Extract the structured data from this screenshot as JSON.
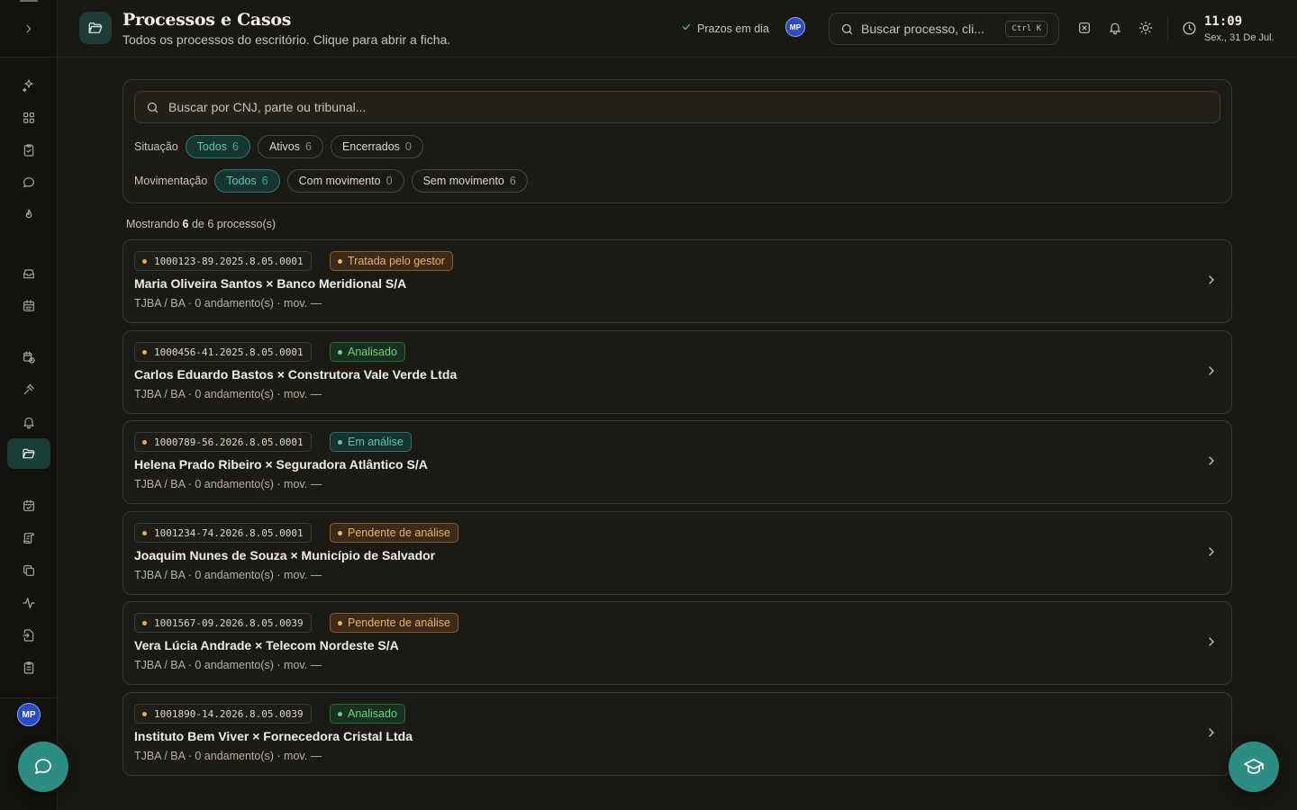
{
  "sidebar": {
    "collapse_icon": "chevron-right-icon",
    "avatar_initials": "MP",
    "items": [
      {
        "name": "sparkles-icon",
        "active": false
      },
      {
        "name": "dashboard-grid-icon",
        "active": false
      },
      {
        "name": "clipboard-check-icon",
        "active": false
      },
      {
        "name": "message-circle-icon",
        "active": false
      },
      {
        "name": "flame-icon",
        "active": false
      },
      {
        "name": "inbox-icon",
        "active": false
      },
      {
        "name": "calendar-icon",
        "active": false
      },
      {
        "name": "calendar-clock-icon",
        "active": false
      },
      {
        "name": "gavel-icon",
        "active": false
      },
      {
        "name": "bell-icon",
        "active": false
      },
      {
        "name": "folder-open-icon",
        "active": true
      },
      {
        "name": "calendar-check-icon",
        "active": false
      },
      {
        "name": "scroll-icon",
        "active": false
      },
      {
        "name": "copy-icon",
        "active": false
      },
      {
        "name": "activity-icon",
        "active": false
      },
      {
        "name": "file-import-icon",
        "active": false
      },
      {
        "name": "clipboard-list-icon",
        "active": false
      }
    ]
  },
  "header": {
    "title": "Processos e Casos",
    "subtitle": "Todos os processos do escritório. Clique para abrir a ficha.",
    "deadline_status": "Prazos em dia",
    "avatar_initials": "MP",
    "search_placeholder": "Buscar processo, cli...",
    "search_shortcut": "Ctrl K",
    "time": "11:09",
    "date": "Sex., 31 De Jul."
  },
  "filters": {
    "search_placeholder": "Buscar por CNJ, parte ou tribunal...",
    "situacao": {
      "label": "Situação",
      "chips": [
        {
          "label": "Todos",
          "count": "6",
          "selected": true
        },
        {
          "label": "Ativos",
          "count": "6",
          "selected": false
        },
        {
          "label": "Encerrados",
          "count": "0",
          "selected": false
        }
      ]
    },
    "movimentacao": {
      "label": "Movimentação",
      "chips": [
        {
          "label": "Todos",
          "count": "6",
          "selected": true
        },
        {
          "label": "Com movimento",
          "count": "0",
          "selected": false
        },
        {
          "label": "Sem movimento",
          "count": "6",
          "selected": false
        }
      ]
    }
  },
  "results": {
    "prefix": "Mostrando ",
    "shown": "6",
    "suffix": " de 6 processo(s)"
  },
  "cases": [
    {
      "cnj": "1000123-89.2025.8.05.0001",
      "status": "Tratada pelo gestor",
      "status_color": "orange",
      "parties": "Maria Oliveira Santos × Banco Meridional S/A",
      "meta": "TJBA / BA · 0 andamento(s) · mov. —"
    },
    {
      "cnj": "1000456-41.2025.8.05.0001",
      "status": "Analisado",
      "status_color": "green",
      "parties": "Carlos Eduardo Bastos × Construtora Vale Verde Ltda",
      "meta": "TJBA / BA · 0 andamento(s) · mov. —"
    },
    {
      "cnj": "1000789-56.2026.8.05.0001",
      "status": "Em análise",
      "status_color": "teal",
      "parties": "Helena Prado Ribeiro × Seguradora Atlântico S/A",
      "meta": "TJBA / BA · 0 andamento(s) · mov. —"
    },
    {
      "cnj": "1001234-74.2026.8.05.0001",
      "status": "Pendente de análise",
      "status_color": "orange",
      "parties": "Joaquim Nunes de Souza × Município de Salvador",
      "meta": "TJBA / BA · 0 andamento(s) · mov. —"
    },
    {
      "cnj": "1001567-09.2026.8.05.0039",
      "status": "Pendente de análise",
      "status_color": "orange",
      "parties": "Vera Lúcia Andrade × Telecom Nordeste S/A",
      "meta": "TJBA / BA · 0 andamento(s) · mov. —"
    },
    {
      "cnj": "1001890-14.2026.8.05.0039",
      "status": "Analisado",
      "status_color": "green",
      "parties": "Instituto Bem Viver × Fornecedora Cristal Ltda",
      "meta": "TJBA / BA · 0 andamento(s) · mov. —"
    }
  ],
  "colors": {
    "accent": "#2f8c80",
    "background": "#1a1813",
    "status_orange": "#f0b06b",
    "status_green": "#6ad08a",
    "status_teal": "#59c4b6"
  },
  "fabs": {
    "chat_icon": "chat-bubble-icon",
    "learn_icon": "graduation-cap-icon"
  }
}
